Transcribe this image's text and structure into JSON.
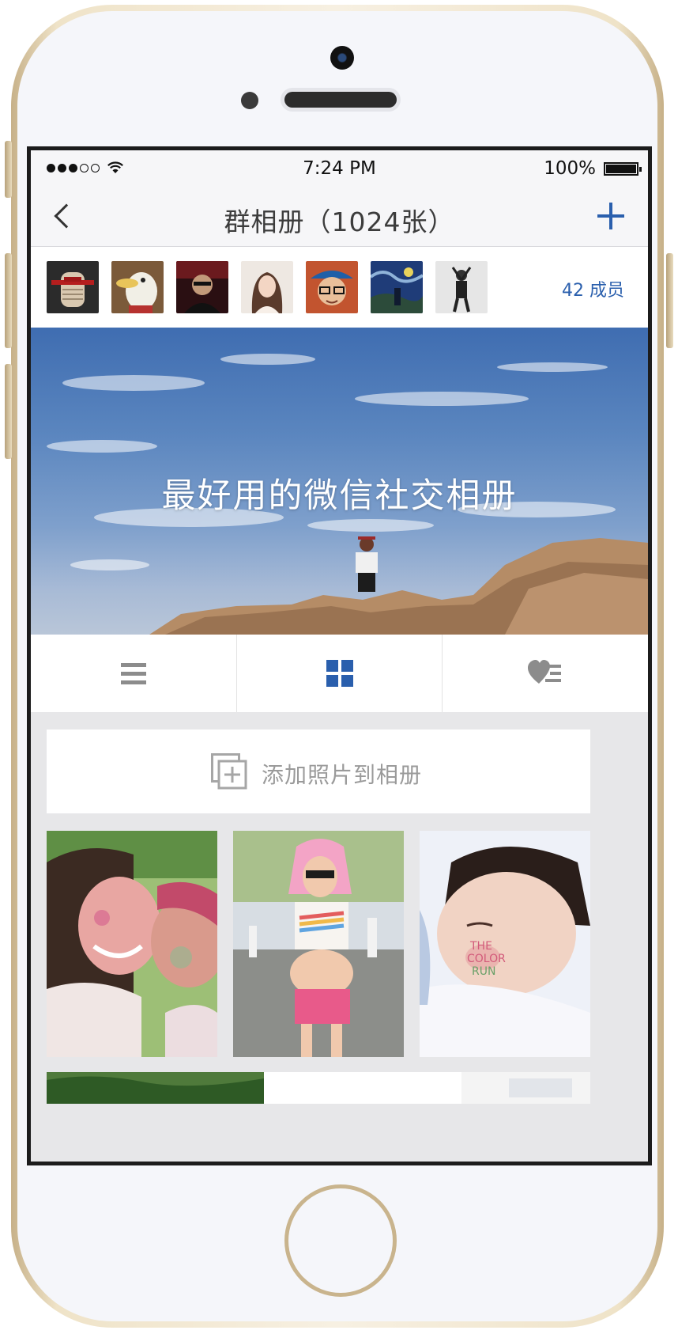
{
  "status_bar": {
    "signal_dots_filled": 3,
    "signal_dots_empty": 2,
    "time": "7:24 PM",
    "battery": "100%",
    "wifi_icon": "wifi-icon"
  },
  "nav": {
    "title": "群相册（1024张）",
    "back_icon": "chevron-left-icon",
    "add_icon": "plus-icon"
  },
  "members": {
    "count_label": "42 成员",
    "avatars": [
      "avatar-1",
      "avatar-2",
      "avatar-3",
      "avatar-4",
      "avatar-5",
      "avatar-6",
      "avatar-7"
    ]
  },
  "hero": {
    "title": "最好用的微信社交相册"
  },
  "view_tabs": {
    "items": [
      "list-view-icon",
      "grid-view-icon",
      "favorites-icon"
    ],
    "active": "grid-view-icon"
  },
  "add_photo": {
    "label": "添加照片到相册"
  },
  "photos": {
    "items": [
      "photo-couple",
      "photo-runner",
      "photo-baby"
    ]
  },
  "colors": {
    "accent": "#2a5fad",
    "nav_bg": "#f6f6f8",
    "content_bg": "#e7e7e9"
  }
}
